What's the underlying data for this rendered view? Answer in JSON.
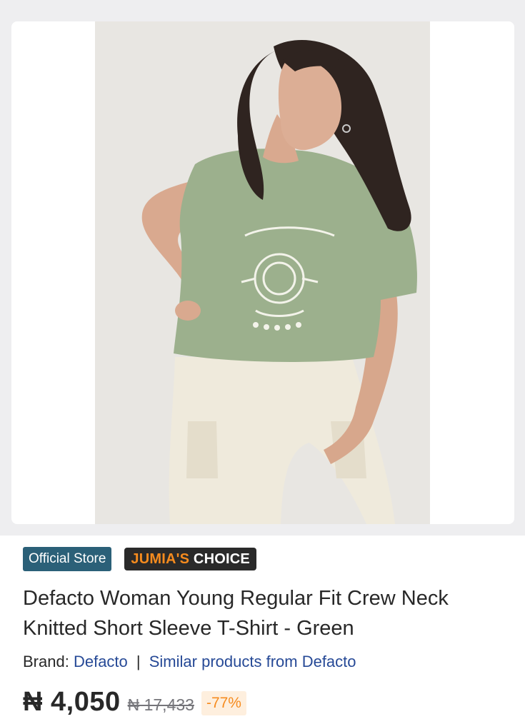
{
  "product": {
    "image_alt": "Woman wearing a green graphic T-shirt and cream cargo pants",
    "badges": {
      "official_store": "Official Store",
      "choice_prefix": "JUMIA'S",
      "choice_suffix": "CHOICE"
    },
    "title": "Defacto Woman Young Regular Fit Crew Neck Knitted Short Sleeve T-Shirt - Green",
    "brand": {
      "label": "Brand:",
      "name": "Defacto",
      "separator": "|",
      "similar_link": "Similar products from Defacto"
    },
    "price": {
      "current": "₦ 4,050",
      "old": "₦ 17,433",
      "discount": "-77%"
    },
    "colors": {
      "accent": "#f68b1e",
      "official_badge": "#2b6078",
      "link": "#264996"
    }
  }
}
